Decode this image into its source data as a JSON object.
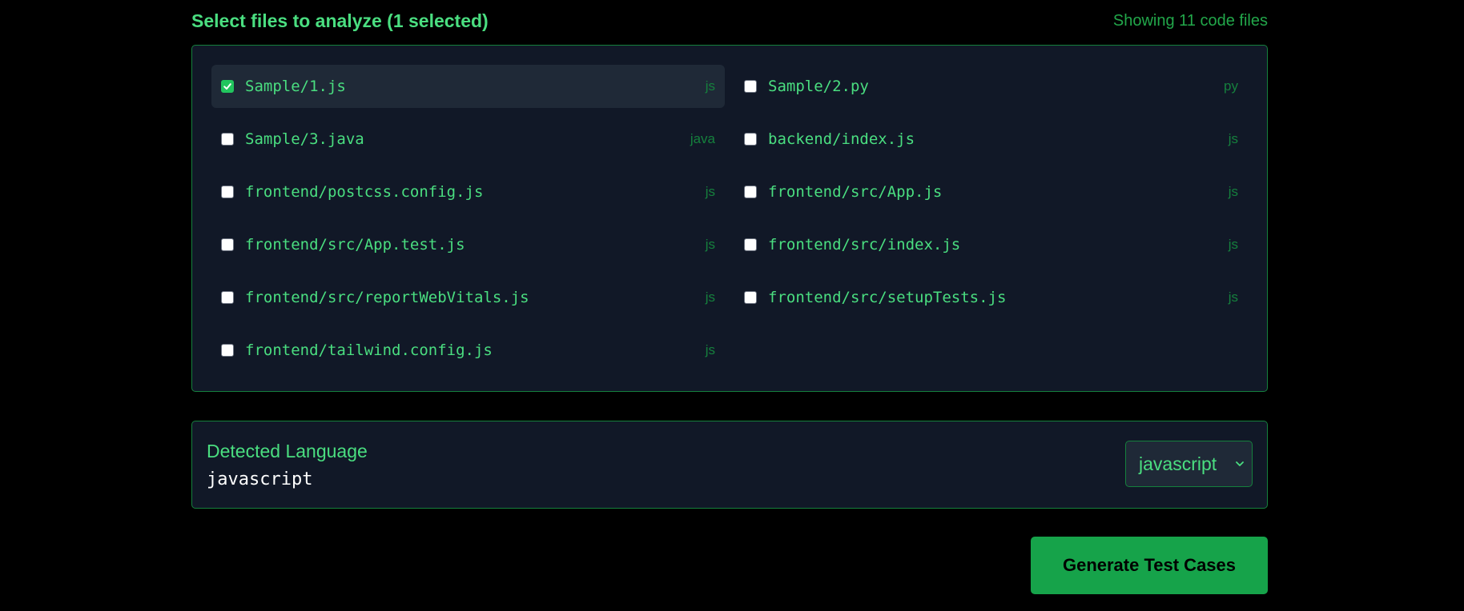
{
  "header": {
    "title": "Select files to analyze (1 selected)",
    "count": "Showing 11 code files"
  },
  "files": [
    {
      "path": "Sample/1.js",
      "ext": "js",
      "checked": true
    },
    {
      "path": "Sample/2.py",
      "ext": "py",
      "checked": false
    },
    {
      "path": "Sample/3.java",
      "ext": "java",
      "checked": false
    },
    {
      "path": "backend/index.js",
      "ext": "js",
      "checked": false
    },
    {
      "path": "frontend/postcss.config.js",
      "ext": "js",
      "checked": false
    },
    {
      "path": "frontend/src/App.js",
      "ext": "js",
      "checked": false
    },
    {
      "path": "frontend/src/App.test.js",
      "ext": "js",
      "checked": false
    },
    {
      "path": "frontend/src/index.js",
      "ext": "js",
      "checked": false
    },
    {
      "path": "frontend/src/reportWebVitals.js",
      "ext": "js",
      "checked": false
    },
    {
      "path": "frontend/src/setupTests.js",
      "ext": "js",
      "checked": false
    },
    {
      "path": "frontend/tailwind.config.js",
      "ext": "js",
      "checked": false
    }
  ],
  "language": {
    "label": "Detected Language",
    "value": "javascript",
    "select_value": "javascript",
    "chevron_icon": "chevron-down-icon"
  },
  "actions": {
    "generate_label": "Generate Test Cases"
  },
  "colors": {
    "background": "#000000",
    "panel": "#111827",
    "accent": "#4ade80",
    "border": "#15803d",
    "button": "#16a34a"
  }
}
